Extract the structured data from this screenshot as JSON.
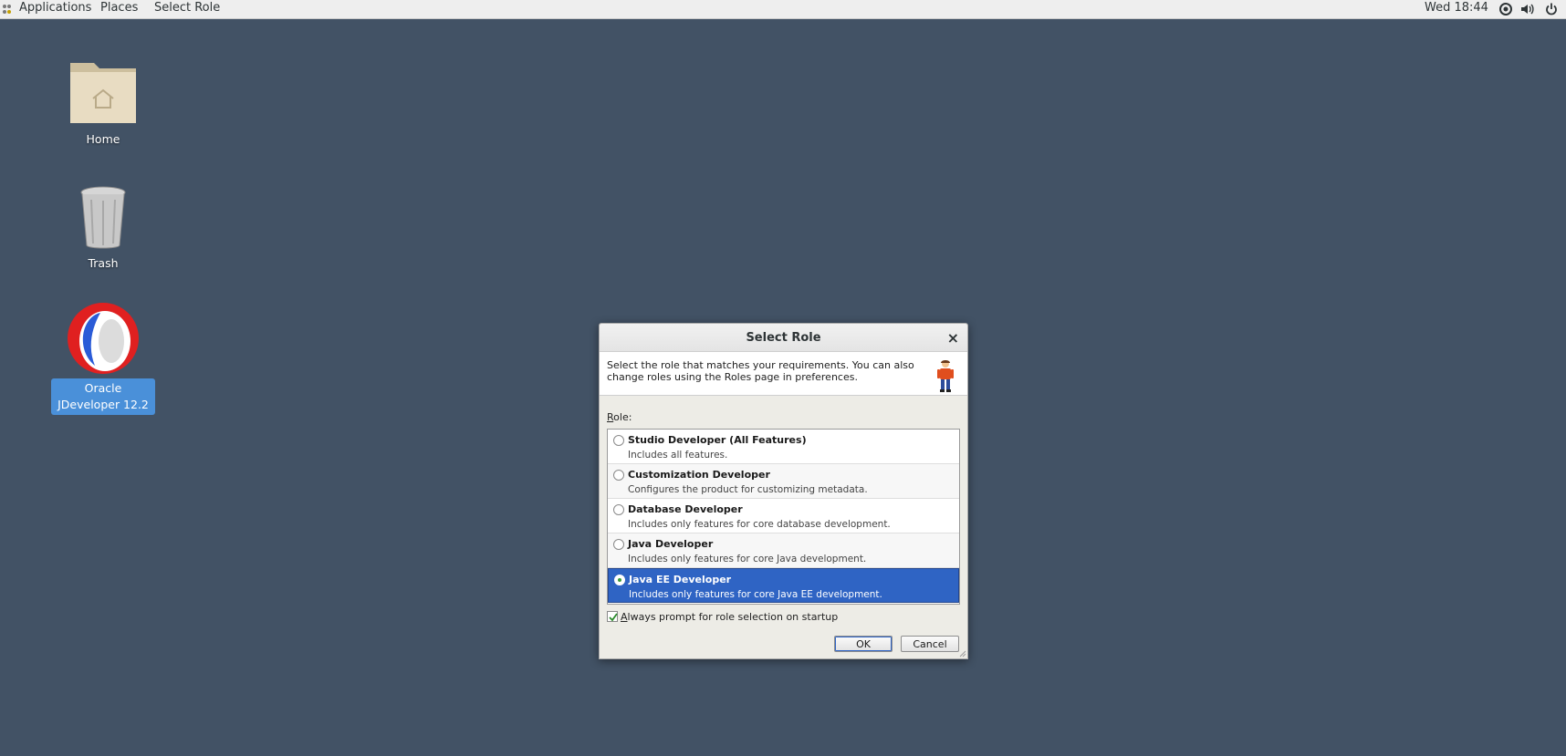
{
  "topbar": {
    "menus": [
      "Applications",
      "Places",
      "Select Role"
    ],
    "clock": "Wed 18:44",
    "tray_icons": [
      "network-icon",
      "volume-icon",
      "power-icon"
    ]
  },
  "desktop": {
    "icons": [
      {
        "label": "Home",
        "icon": "folder-home-icon"
      },
      {
        "label": "Trash",
        "icon": "trash-icon"
      },
      {
        "label": "Oracle JDeveloper 12.2",
        "icon": "jdeveloper-icon",
        "selected": true
      }
    ]
  },
  "dialog": {
    "title": "Select Role",
    "close_glyph": "×",
    "description": "Select the role that matches your requirements. You can also change roles using the Roles page in preferences.",
    "role_label_mnemonic": "R",
    "role_label_rest": "ole:",
    "roles": [
      {
        "name": "Studio Developer (All Features)",
        "desc": "Includes all features."
      },
      {
        "name": "Customization Developer",
        "desc": "Configures the product for customizing metadata."
      },
      {
        "name": "Database Developer",
        "desc": "Includes only features for core database development."
      },
      {
        "name": "Java Developer",
        "desc": "Includes only features for core Java development."
      },
      {
        "name": "Java EE Developer",
        "desc": "Includes only features for core Java EE development."
      }
    ],
    "selected_role_index": 4,
    "prompt_mnemonic": "A",
    "prompt_rest": "lways prompt for role selection on startup",
    "prompt_checked": true,
    "ok_label": "OK",
    "cancel_label": "Cancel"
  },
  "colors": {
    "desktop_bg": "#425265",
    "selection": "#2f64c4",
    "icon_selection": "#4a90d9"
  }
}
